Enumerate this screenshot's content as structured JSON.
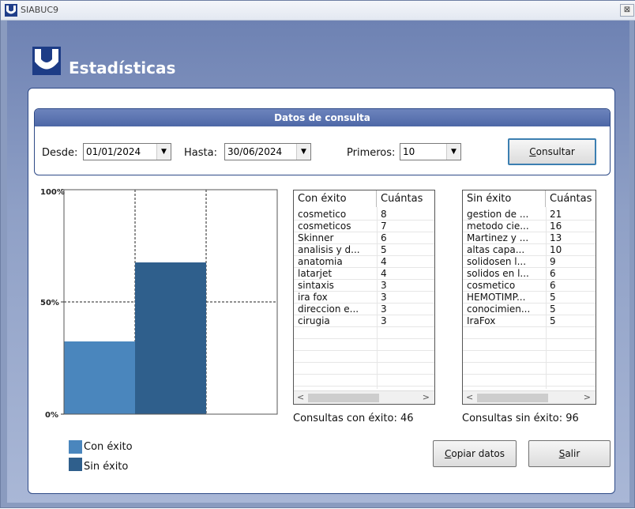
{
  "window": {
    "title": "SIABUC9",
    "close_glyph": "⊠"
  },
  "header": {
    "title": "Estadísticas"
  },
  "query": {
    "heading": "Datos de consulta",
    "desde_label": "Desde:",
    "desde_value": "01/01/2024",
    "hasta_label": "Hasta:",
    "hasta_value": "30/06/2024",
    "primeros_label": "Primeros:",
    "primeros_value": "10",
    "consultar_label_u": "C",
    "consultar_label_rest": "onsultar"
  },
  "chart_data": {
    "type": "bar",
    "categories": [
      "Con éxito",
      "Sin éxito"
    ],
    "values": [
      46,
      96
    ],
    "percent": [
      32.4,
      67.6
    ],
    "yticks": [
      "100%",
      "50%",
      "0%"
    ],
    "ylim": [
      0,
      100
    ],
    "colors": {
      "Con éxito": "#4a86bd",
      "Sin éxito": "#2f5f8c"
    },
    "legend": [
      "Con éxito",
      "Sin éxito"
    ],
    "legend_placement": "bottom-left",
    "grid": true
  },
  "list_con": {
    "headers": [
      "Con éxito",
      "Cuántas"
    ],
    "rows": [
      [
        "cosmetico",
        "8"
      ],
      [
        "cosmeticos",
        "7"
      ],
      [
        "Skinner",
        "6"
      ],
      [
        "analisis y d...",
        "5"
      ],
      [
        "anatomia",
        "4"
      ],
      [
        "latarjet",
        "4"
      ],
      [
        "sintaxis",
        "3"
      ],
      [
        "ira fox",
        "3"
      ],
      [
        "direccion e...",
        "3"
      ],
      [
        "cirugia",
        "3"
      ]
    ],
    "summary": "Consultas con éxito: 46"
  },
  "list_sin": {
    "headers": [
      "Sin éxito",
      "Cuántas"
    ],
    "rows": [
      [
        "gestion de ...",
        "21"
      ],
      [
        "metodo cie...",
        "16"
      ],
      [
        "Martinez y ...",
        "13"
      ],
      [
        "altas capa...",
        "10"
      ],
      [
        "solidosen l...",
        "9"
      ],
      [
        "solidos en l...",
        "6"
      ],
      [
        "cosmetico",
        "6"
      ],
      [
        "HEMOTIMP...",
        "5"
      ],
      [
        "conocimien...",
        "5"
      ],
      [
        "IraFox",
        "5"
      ]
    ],
    "summary": "Consultas sin éxito: 96"
  },
  "buttons": {
    "copiar_u": "C",
    "copiar_rest": "opiar datos",
    "salir_u": "S",
    "salir_rest": "alir"
  },
  "scroll": {
    "left": "<",
    "right": ">"
  }
}
